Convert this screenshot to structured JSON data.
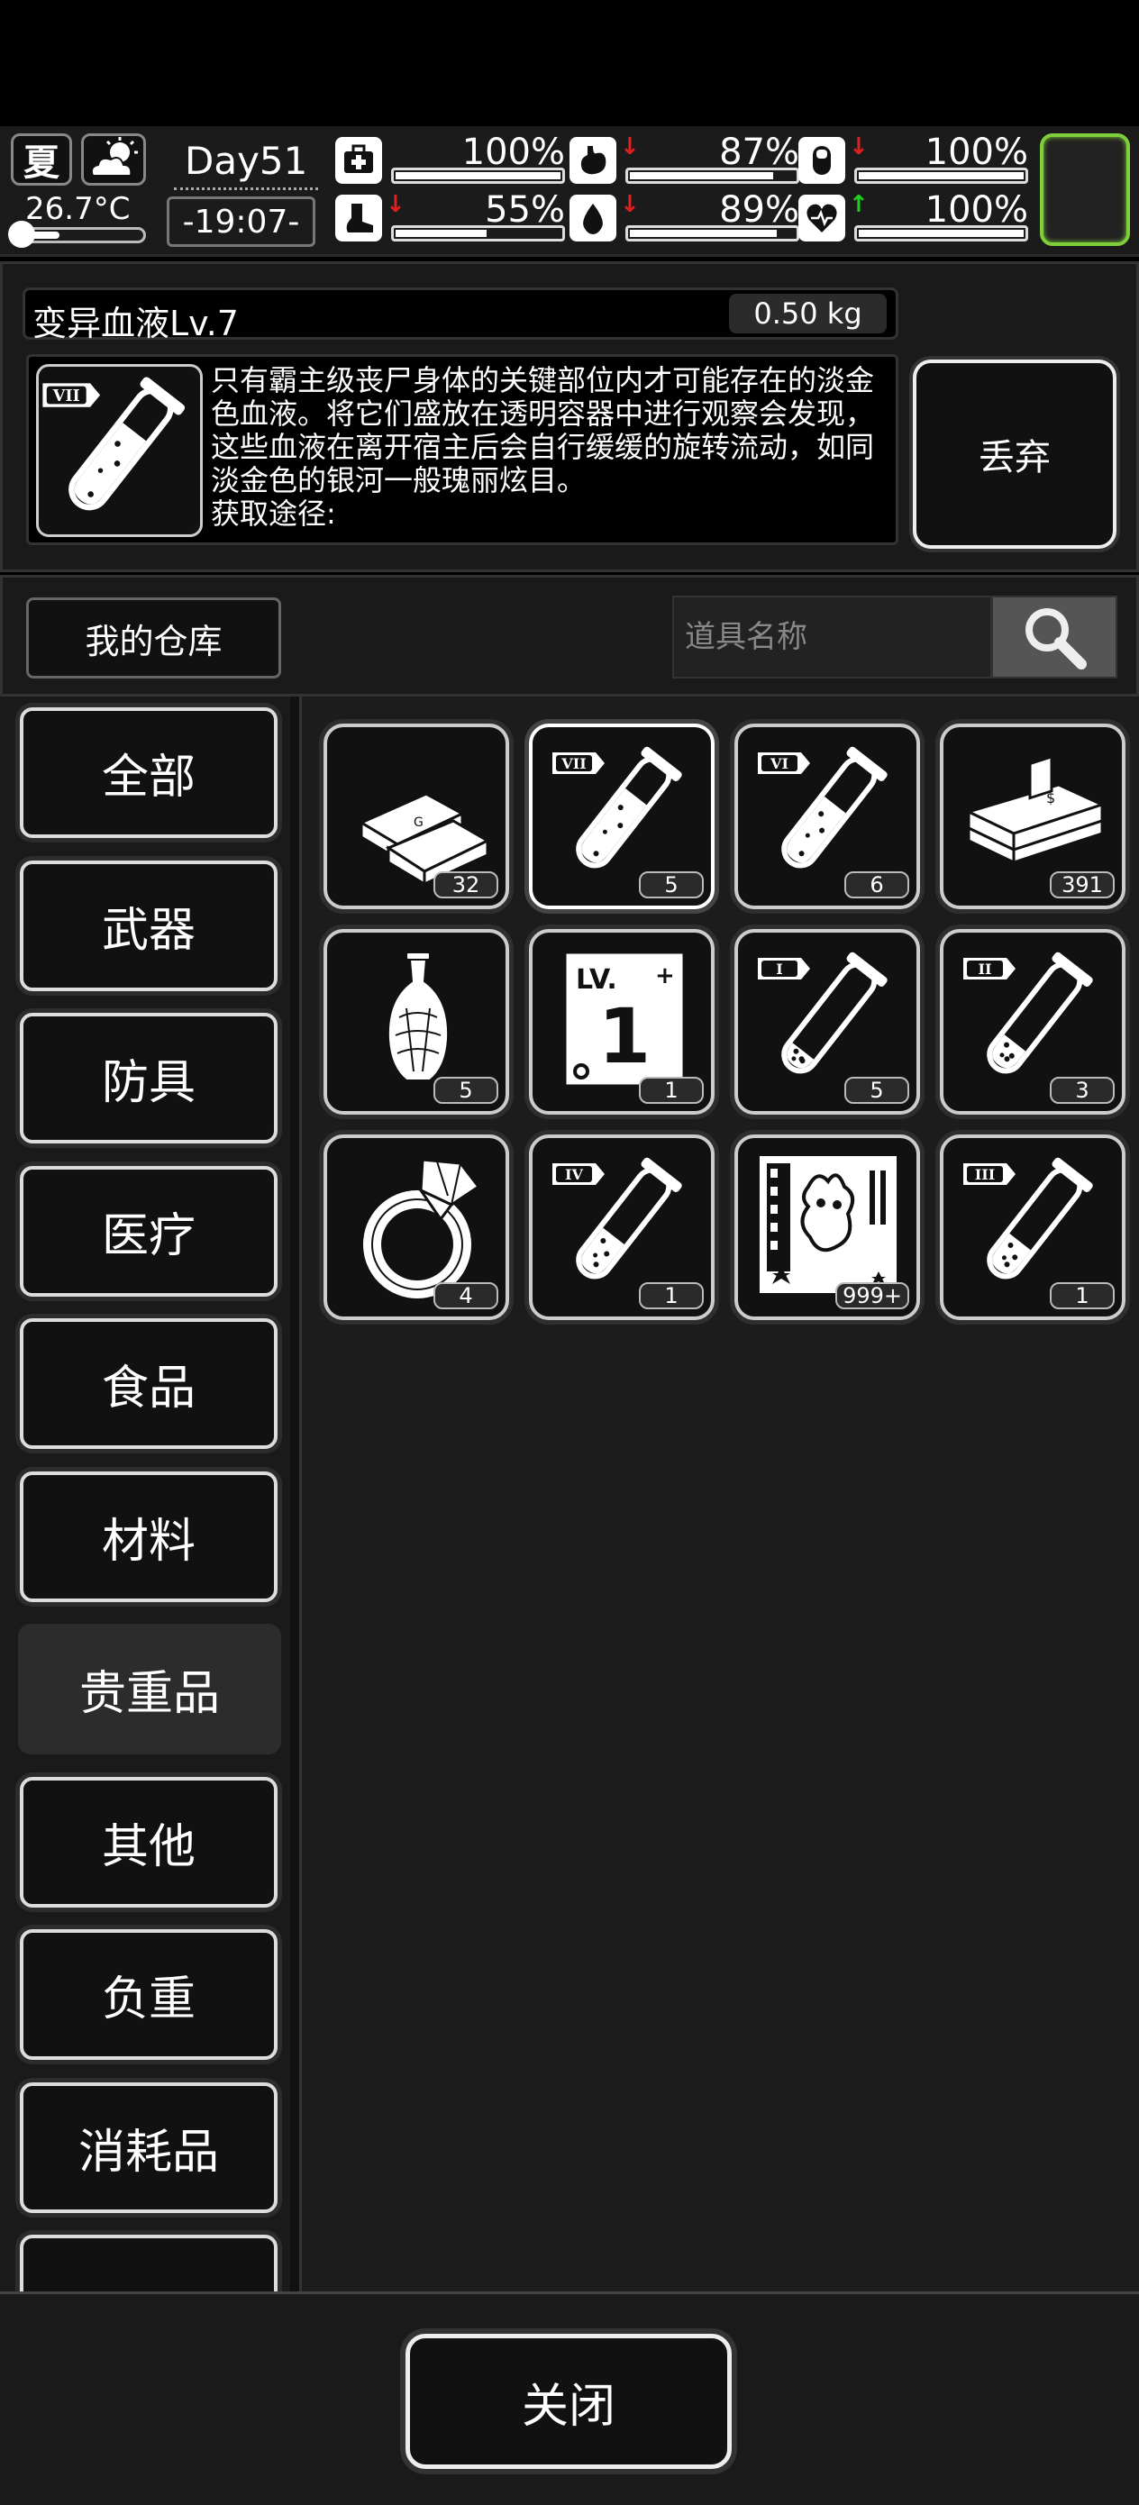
{
  "status": {
    "season": "夏",
    "weather_icon": "partly-cloudy-icon",
    "temperature": "26.7°C",
    "temperature_level": 0.35,
    "day": "Day51",
    "time": "-19:07-",
    "stats": [
      {
        "name": "health",
        "icon": "medkit-icon",
        "value": "100%",
        "level": 1.0,
        "trend": ""
      },
      {
        "name": "hunger",
        "icon": "stomach-icon",
        "value": "87%",
        "level": 0.87,
        "trend": "down"
      },
      {
        "name": "immunity",
        "icon": "pill-icon",
        "value": "100%",
        "level": 1.0,
        "trend": "down"
      },
      {
        "name": "stamina",
        "icon": "boot-icon",
        "value": "55%",
        "level": 0.55,
        "trend": "down"
      },
      {
        "name": "thirst",
        "icon": "water-drop-icon",
        "value": "89%",
        "level": 0.89,
        "trend": "down"
      },
      {
        "name": "mood",
        "icon": "heart-icon",
        "value": "100%",
        "level": 1.0,
        "trend": "up"
      }
    ],
    "colors": {
      "trend_down": "#e02020",
      "trend_up": "#20d020",
      "slot_border": "#7fcf3a"
    }
  },
  "detail": {
    "item_name": "变异血液Lv.7",
    "weight": "0.50 kg",
    "icon_numeral": "VII",
    "description": "只有霸主级丧尸身体的关键部位内才可能存在的淡金色血液。将它们盛放在透明容器中进行观察会发现，这些血液在离开宿主后会自行缓缓的旋转流动，如同淡金色的银河一般瑰丽炫目。",
    "source_label": "获取途径:",
    "discard_label": "丢弃"
  },
  "toolbar": {
    "warehouse_label": "我的仓库",
    "search_placeholder": "道具名称"
  },
  "categories": [
    {
      "label": "全部",
      "active": false
    },
    {
      "label": "武器",
      "active": false
    },
    {
      "label": "防具",
      "active": false
    },
    {
      "label": "医疗",
      "active": false
    },
    {
      "label": "食品",
      "active": false
    },
    {
      "label": "材料",
      "active": false
    },
    {
      "label": "贵重品",
      "active": true
    },
    {
      "label": "其他",
      "active": false
    },
    {
      "label": "负重",
      "active": false
    },
    {
      "label": "消耗品",
      "active": false
    }
  ],
  "items": [
    {
      "icon": "gold-bars-icon",
      "count": "32"
    },
    {
      "icon": "blood-vial-icon",
      "numeral": "VII",
      "count": "5",
      "selected": true,
      "fill": 0.8
    },
    {
      "icon": "blood-vial-icon",
      "numeral": "VI",
      "count": "6",
      "fill": 0.7
    },
    {
      "icon": "cash-stack-icon",
      "count": "391"
    },
    {
      "icon": "porcelain-vase-icon",
      "count": "5"
    },
    {
      "icon": "level-card-icon",
      "count": "1"
    },
    {
      "icon": "blood-vial-icon",
      "numeral": "I",
      "count": "5",
      "fill": 0.2
    },
    {
      "icon": "blood-vial-icon",
      "numeral": "II",
      "count": "3",
      "fill": 0.3
    },
    {
      "icon": "diamond-ring-icon",
      "count": "4"
    },
    {
      "icon": "blood-vial-icon",
      "numeral": "IV",
      "count": "1",
      "fill": 0.45
    },
    {
      "icon": "monster-card-icon",
      "count": "999+"
    },
    {
      "icon": "blood-vial-icon",
      "numeral": "III",
      "count": "1",
      "fill": 0.38
    }
  ],
  "footer": {
    "close_label": "关闭"
  }
}
